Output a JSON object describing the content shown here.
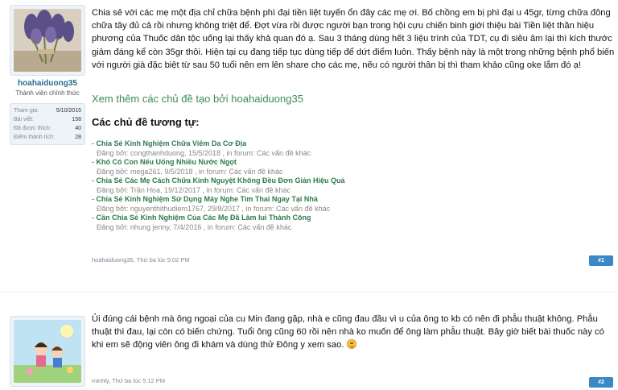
{
  "posts": [
    {
      "user": {
        "name": "hoahaiduong35",
        "title": "Thành viên chính thức",
        "stats": [
          {
            "label": "Tham gia:",
            "value": "5/10/2015"
          },
          {
            "label": "Bài viết:",
            "value": "158"
          },
          {
            "label": "Đã được thích:",
            "value": "40"
          },
          {
            "label": "Điểm thành tích:",
            "value": "28"
          }
        ]
      },
      "text": "Chia sẻ với các mẹ một địa chỉ chữa bệnh phì đại tiền liệt tuyến ổn đây các mẹ ơi. Bố chồng em bị phì đại u 45gr, từng chữa đông chữa tây đủ cả rồi nhưng không triệt để. Đợt vừa rồi được người bạn trong hội cựu chiến binh giới thiệu bài Tiền liệt thần hiệu phương của Thuốc dân tộc uống lại thấy khả quan đó ạ. Sau 3 tháng dùng hết 3 liệu trình của TDT, cụ đi siêu âm lại thì kích thước giảm đáng kể còn 35gr thôi. Hiện tại cụ đang tiếp tục dùng tiếp để dứt điểm luôn. Thấy bệnh này là một trong những bệnh phổ biến với người già đặc biệt từ sau 50 tuổi nên em lên share cho các mẹ, nếu có người thân bị thì tham khảo cũng oke lắm đó ạ!",
      "see_more": "Xem thêm các chủ đề tạo bởi hoahaiduong35",
      "similar_title": "Các chủ đề tương tự:",
      "similar_threads": [
        {
          "title": "Chia Sẻ Kinh Nghiệm Chữa Viêm Da Cơ Địa",
          "meta": "Đăng bởi: congthanhduong, 15/5/2018 , in forum: Các vấn đề khác"
        },
        {
          "title": "Khó Có Con Nếu Uống Nhiều Nước Ngọt",
          "meta": "Đăng bởi: mega261, 9/5/2018 , in forum: Các vấn đề khác"
        },
        {
          "title": "Chia Sẻ Các Mẹ Cách Chữa Kinh Nguyệt Không Đều Đơn Giản Hiệu Quả",
          "meta": "Đăng bởi: Trần Hoa, 19/12/2017 , in forum: Các vấn đề khác"
        },
        {
          "title": "Chia Sẻ Kinh Nghiệm Sử Dụng Máy Nghe Tim Thai Ngay Tại Nhà",
          "meta": "Đăng bởi: nguyenthithudiem1767, 29/8/2017 , in forum: Các vấn đề khác"
        },
        {
          "title": "Cần Chia Sẻ Kinh Nghiệm Của Các Mẹ Đã Làm Iui Thành Công",
          "meta": "Đăng bởi: nhung jenny, 7/4/2016 , in forum: Các vấn đề khác"
        }
      ],
      "footer": "hoahaiduong35, Thứ ba lúc 5:02 PM",
      "permalink": "#1"
    },
    {
      "user": {
        "name": "minhly"
      },
      "text": "Ủi đúng cái bệnh mà ông ngoại của cu Min đang gặp, nhà e cũng đau đầu vì u của ông to kb có nên đi phẫu thuật không. Phẫu thuật thì đau, lại còn có biến chứng. Tuổi ông cũng 60 rồi nên nhà ko muốn để ông làm phẫu thuật. Bây giờ biết bài thuốc này có khi em sẽ động viên ông đi khám và dùng thử Đông y xem sao.",
      "footer": "minhly, Thứ ba lúc 5:12 PM",
      "permalink": "#2"
    }
  ]
}
